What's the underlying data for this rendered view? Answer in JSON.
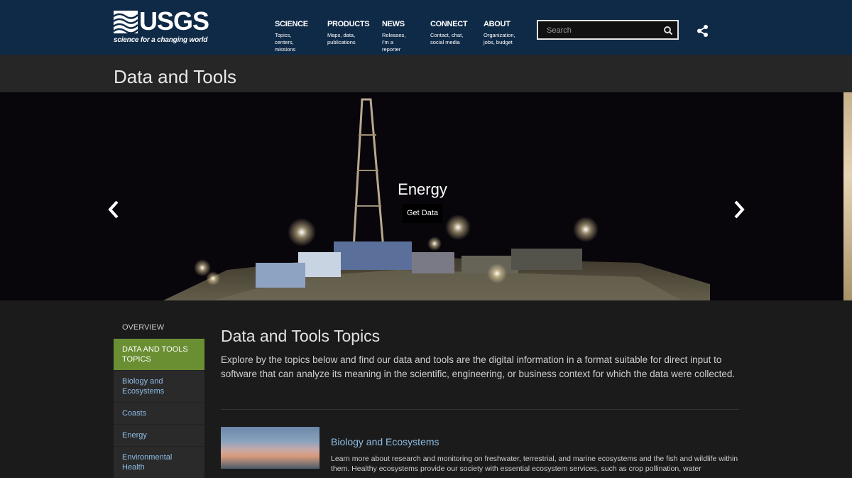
{
  "header": {
    "logo_word": "USGS",
    "logo_tagline": "science for a changing world",
    "nav": [
      {
        "title": "SCIENCE",
        "sub": "Topics, centers,\nmissions"
      },
      {
        "title": "PRODUCTS",
        "sub": "Maps, data,\npublications"
      },
      {
        "title": "NEWS",
        "sub": "Releases,\nI'm a reporter"
      },
      {
        "title": "CONNECT",
        "sub": "Contact, chat,\nsocial media"
      },
      {
        "title": "ABOUT",
        "sub": "Organization,\njobs, budget"
      }
    ],
    "search_placeholder": "Search",
    "icons": {
      "search": "search-icon",
      "share": "share-icon"
    }
  },
  "page": {
    "title": "Data and Tools"
  },
  "hero": {
    "title": "Energy",
    "button": "Get Data"
  },
  "sidebar": {
    "heading": "OVERVIEW",
    "items": [
      {
        "label": "DATA AND TOOLS TOPICS",
        "active": true
      },
      {
        "label": "Biology and Ecosystems"
      },
      {
        "label": "Coasts"
      },
      {
        "label": "Energy"
      },
      {
        "label": "Environmental Health"
      }
    ]
  },
  "main": {
    "heading": "Data and Tools Topics",
    "intro": "Explore by the topics below and find our data and tools are the digital information in a format suitable for direct input to software that can analyze its meaning in the scientific, engineering, or business context for which the data were collected.",
    "card": {
      "title": "Biology and Ecosystems",
      "text": "Learn more about research and monitoring on freshwater, terrestrial, and marine ecosystems and the fish and wildlife within them. Healthy ecosystems provide our society with essential ecosystem services, such as crop pollination, water"
    }
  },
  "colors": {
    "header_bg": "#0f2a47",
    "active_item": "#6a8f32",
    "link": "#8fbde6"
  }
}
